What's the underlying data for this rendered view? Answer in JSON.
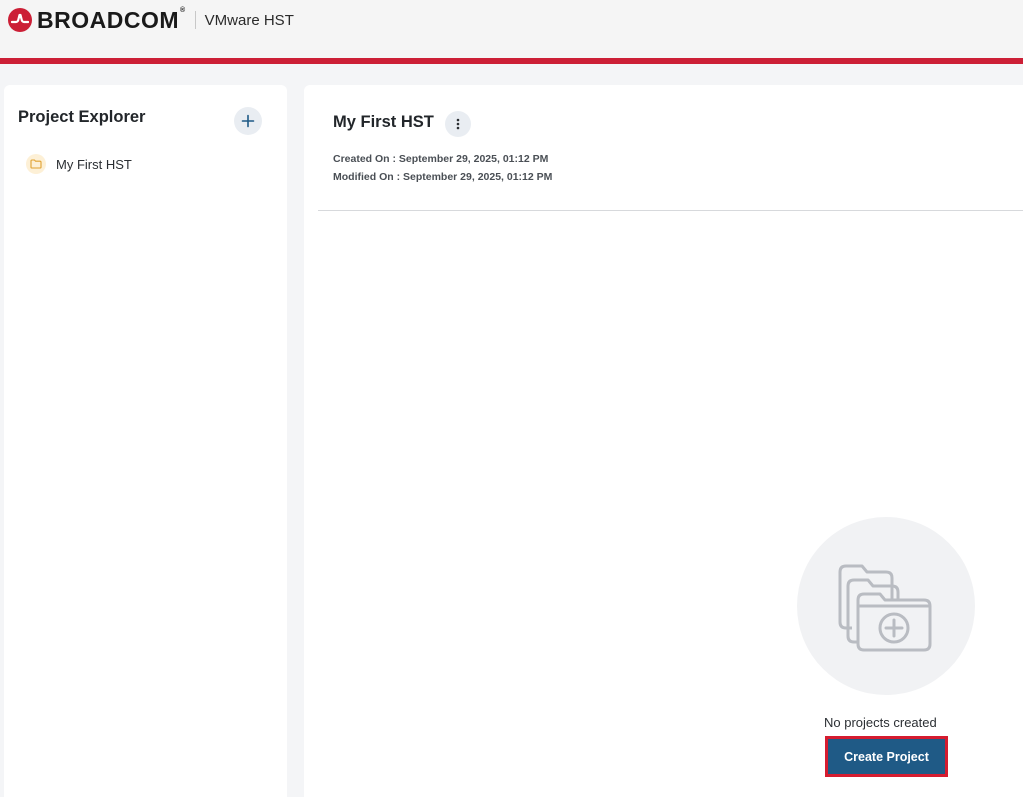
{
  "header": {
    "brand_name": "BROADCOM",
    "brand_mark": "®",
    "product_name": "VMware HST",
    "accent_color": "#cc1f36"
  },
  "explorer": {
    "title": "Project Explorer",
    "add_icon": "plus-icon",
    "items": [
      {
        "label": "My First HST",
        "icon": "folder-icon"
      }
    ]
  },
  "main": {
    "title": "My First HST",
    "menu_icon": "kebab-icon",
    "created_on": "Created On : September 29, 2025, 01:12 PM",
    "modified_on": "Modified On : September 29, 2025, 01:12 PM",
    "empty_state": {
      "illustration_icon": "folder-add-icon",
      "message": "No projects created",
      "button_label": "Create Project",
      "button_color": "#1f5a86"
    }
  }
}
